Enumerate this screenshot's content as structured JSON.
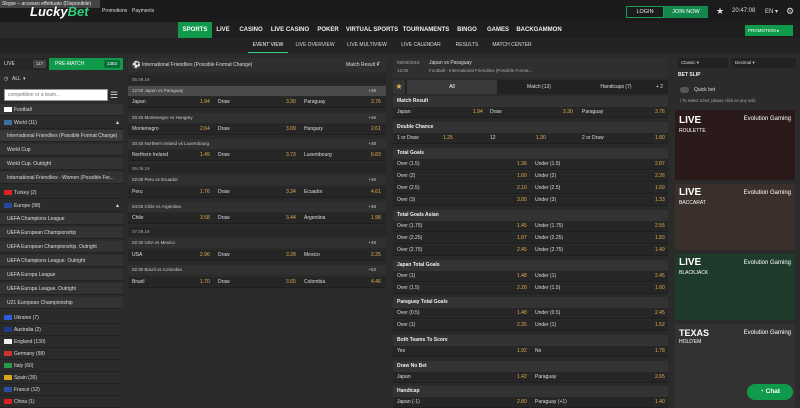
{
  "skype_banner": "Skype – accesso effettuato (Disponibile)",
  "logo": {
    "a": "Lucky",
    "b": "Bet"
  },
  "top_links": [
    "Promotions",
    "Payments"
  ],
  "auth": {
    "login": "LOGIN",
    "join": "JOIN NOW"
  },
  "time": "20:47:08",
  "lang": "EN",
  "categories": [
    "SPORTS",
    "LIVE",
    "CASINO",
    "LIVE CASINO",
    "POKER",
    "VIRTUAL SPORTS",
    "TOURNAMENTS",
    "BINGO",
    "GAMES",
    "BACKGAMMON"
  ],
  "promotion": "PROMOTION",
  "subnav": [
    "EVENT VIEW",
    "LIVE OVERVIEW",
    "LIVE MULTIVIEW",
    "LIVE CALENDAR",
    "RESULTS",
    "MATCH CENTER"
  ],
  "sidebar": {
    "live": "LIVE",
    "live_count": "117",
    "prematch": "PRE-MATCH",
    "prematch_count": "1383",
    "all": "ALL",
    "search_placeholder": "competition or a team...",
    "football": "Football",
    "world": "World (11)",
    "world_items": [
      "International Friendlies (Possible Format Change)",
      "World Cup",
      "World Cup. Outright",
      "International Friendlies - Women (Possible For..."
    ],
    "turkey": "Turkey (2)",
    "europe": "Europe (98)",
    "europe_items": [
      "UEFA Champions League",
      "UEFA European Championship",
      "UEFA European Championship. Outright",
      "UEFA Champions League. Outright",
      "UEFA Europa League",
      "UEFA Europa League. Outright",
      "U21 European Championship"
    ],
    "countries": [
      "Ukraine (7)",
      "Australia (2)",
      "England (130)",
      "Germany (58)",
      "Italy (60)",
      "Spain (35)",
      "France (12)",
      "China (1)"
    ]
  },
  "main": {
    "title": "International Friendlies (Possible Format Change)",
    "market": "Match Result",
    "dates": [
      "05.09.19",
      "06.09.19",
      "07.09.19"
    ],
    "matches": [
      {
        "time": "12:00",
        "home": "Japan",
        "away": "Paraguay",
        "plus": "+48",
        "o1": "1.94",
        "x": "Draw",
        "ox": "3.30",
        "o2": "3.76"
      },
      {
        "time": "20:45",
        "home": "Montenegro",
        "away": "Hungary",
        "plus": "+46",
        "o1": "2.64",
        "x": "Draw",
        "ox": "3.09",
        "o2": "2.61"
      },
      {
        "time": "20:45",
        "home": "Northern Ireland",
        "away": "Luxembourg",
        "plus": "+48",
        "o1": "1.49",
        "x": "Draw",
        "ox": "3.73",
        "o2": "6.83"
      },
      {
        "time": "02:00",
        "home": "Peru",
        "away": "Ecuador",
        "plus": "+46",
        "o1": "1.76",
        "x": "Draw",
        "ox": "3.34",
        "o2": "4.61"
      },
      {
        "time": "04:00",
        "home": "Chile",
        "away": "Argentina",
        "plus": "+48",
        "o1": "3.58",
        "x": "Draw",
        "ox": "3.44",
        "o2": "1.98"
      },
      {
        "time": "02:30",
        "home": "USA",
        "away": "Mexico",
        "plus": "+48",
        "o1": "2.96",
        "x": "Draw",
        "ox": "3.28",
        "o2": "2.25"
      },
      {
        "time": "02:30",
        "home": "Brazil",
        "away": "Colombia",
        "plus": "+53",
        "o1": "1.70",
        "x": "Draw",
        "ox": "3.65",
        "o2": "4.46"
      }
    ]
  },
  "detail": {
    "date": "05/09/2019",
    "time": "12:00",
    "teams": "Japan vs Paraguay",
    "comp": "Football - International Friendlies (Possible Forma...",
    "tabs": [
      "All",
      "Match (13)",
      "Handicaps (7)"
    ],
    "tabs_plus": "+ 2",
    "markets": [
      {
        "title": "Match Result",
        "rows": [
          [
            "Japan",
            "1.94",
            "Draw",
            "3.30",
            "Paraguay",
            "3.76"
          ]
        ]
      },
      {
        "title": "Double Chance",
        "rows": [
          [
            "1 or Draw",
            "1.25",
            "12",
            "1.30",
            "2 or Draw",
            "1.80"
          ]
        ]
      },
      {
        "title": "Total Goals",
        "rows": [
          [
            "Over (1.5)",
            "1.36",
            "Under (1.5)",
            "2.87"
          ],
          [
            "Over (2)",
            "1.60",
            "Under (2)",
            "2.26"
          ],
          [
            "Over (2.5)",
            "2.10",
            "Under (2.5)",
            "1.69"
          ],
          [
            "Over (3)",
            "3.05",
            "Under (3)",
            "1.33"
          ]
        ]
      },
      {
        "title": "Total Goals Asian",
        "rows": [
          [
            "Over (1.75)",
            "1.45",
            "Under (1.75)",
            "2.55"
          ],
          [
            "Over (2.25)",
            "1.87",
            "Under (2.25)",
            "1.83"
          ],
          [
            "Over (2.75)",
            "2.45",
            "Under (2.75)",
            "1.49"
          ]
        ]
      },
      {
        "title": "Japan Total Goals",
        "rows": [
          [
            "Over (1)",
            "1.48",
            "Under (1)",
            "2.45"
          ],
          [
            "Over (1.5)",
            "2.20",
            "Under (1.5)",
            "1.60"
          ]
        ]
      },
      {
        "title": "Paraguay Total Goals",
        "rows": [
          [
            "Over (0.5)",
            "1.48",
            "Under (0.5)",
            "2.45"
          ],
          [
            "Over (1)",
            "2.35",
            "Under (1)",
            "1.52"
          ]
        ]
      },
      {
        "title": "Both Teams To Score",
        "rows": [
          [
            "Yes",
            "1.92",
            "No",
            "1.78"
          ]
        ]
      },
      {
        "title": "Draw No Bet",
        "rows": [
          [
            "Japan",
            "1.42",
            "Paraguay",
            "2.65"
          ]
        ]
      },
      {
        "title": "Handicap",
        "rows": [
          [
            "Japan (-1)",
            "2.80",
            "Paraguay (+1)",
            "1.40"
          ]
        ]
      }
    ]
  },
  "betslip": {
    "classic": "Classic",
    "decimal": "Decimal",
    "title": "BET SLIP",
    "quick": "Quick bet",
    "hint": "i To select a bet, please click on any odd."
  },
  "casino": [
    {
      "t": "LIVE",
      "s": "ROULETTE"
    },
    {
      "t": "LIVE",
      "s": "BACCARAT"
    },
    {
      "t": "LIVE",
      "s": "BLACKJACK"
    },
    {
      "t": "TEXAS",
      "s": "HOLD'EM"
    }
  ],
  "evolution": "Evolution Gaming",
  "chat": "Chat"
}
